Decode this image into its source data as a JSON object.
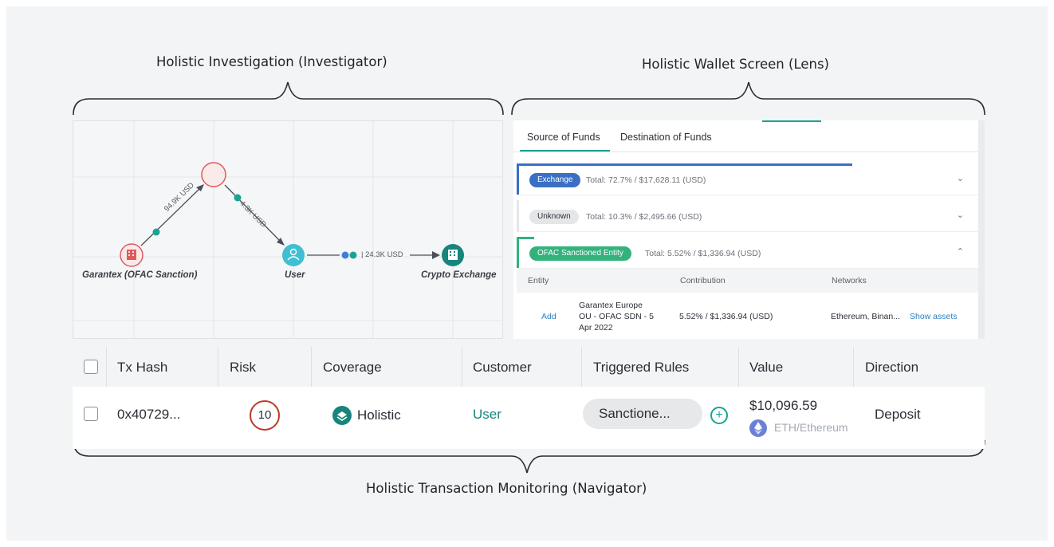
{
  "captions": {
    "investigator": "Holistic Investigation (Investigator)",
    "lens": "Holistic Wallet Screen (Lens)",
    "navigator": "Holistic Transaction Monitoring (Navigator)"
  },
  "graph": {
    "nodes": {
      "garantex": "Garantex (OFAC Sanction)",
      "user": "User",
      "exchange": "Crypto Exchange"
    },
    "edges": {
      "e1": "94.9K USD",
      "e2": "4.3K USD",
      "e3": "24.3K USD"
    },
    "colors": {
      "sanction": "#e05a5a",
      "user": "#3fbfd1",
      "exchange": "#17857c",
      "badge": "#1aa394",
      "badge_blue": "#3d7fd6"
    }
  },
  "lens": {
    "tabs": [
      "Source of Funds",
      "Destination of Funds"
    ],
    "rows": [
      {
        "label": "Exchange",
        "total": "Total: 72.7% / $17,628.11 (USD)",
        "color": "#3a6fc4",
        "fill": 0.727
      },
      {
        "label": "Unknown",
        "total": "Total: 10.3% / $2,495.66 (USD)",
        "color": "#e4e6e8"
      },
      {
        "label": "OFAC Sanctioned Entity",
        "total": "Total: 5.52% / $1,336.94 (USD)",
        "color": "#33b27c"
      }
    ],
    "table": {
      "headers": [
        "Entity",
        "Contribution",
        "Networks"
      ],
      "row": {
        "action": "Add",
        "entity": [
          "Garantex Europe",
          "OU - OFAC SDN - 5",
          "Apr 2022"
        ],
        "contribution": "5.52% / $1,336.94 (USD)",
        "networks": "Ethereum, Binan...",
        "show_assets": "Show assets"
      }
    }
  },
  "navigator": {
    "headers": [
      "Tx Hash",
      "Risk",
      "Coverage",
      "Customer",
      "Triggered Rules",
      "Value",
      "Direction"
    ],
    "row": {
      "tx_hash": "0x40729...",
      "risk": "10",
      "coverage": "Holistic",
      "customer": "User",
      "rule": "Sanctione...",
      "value": "$10,096.59",
      "asset": "ETH/Ethereum",
      "direction": "Deposit"
    }
  }
}
